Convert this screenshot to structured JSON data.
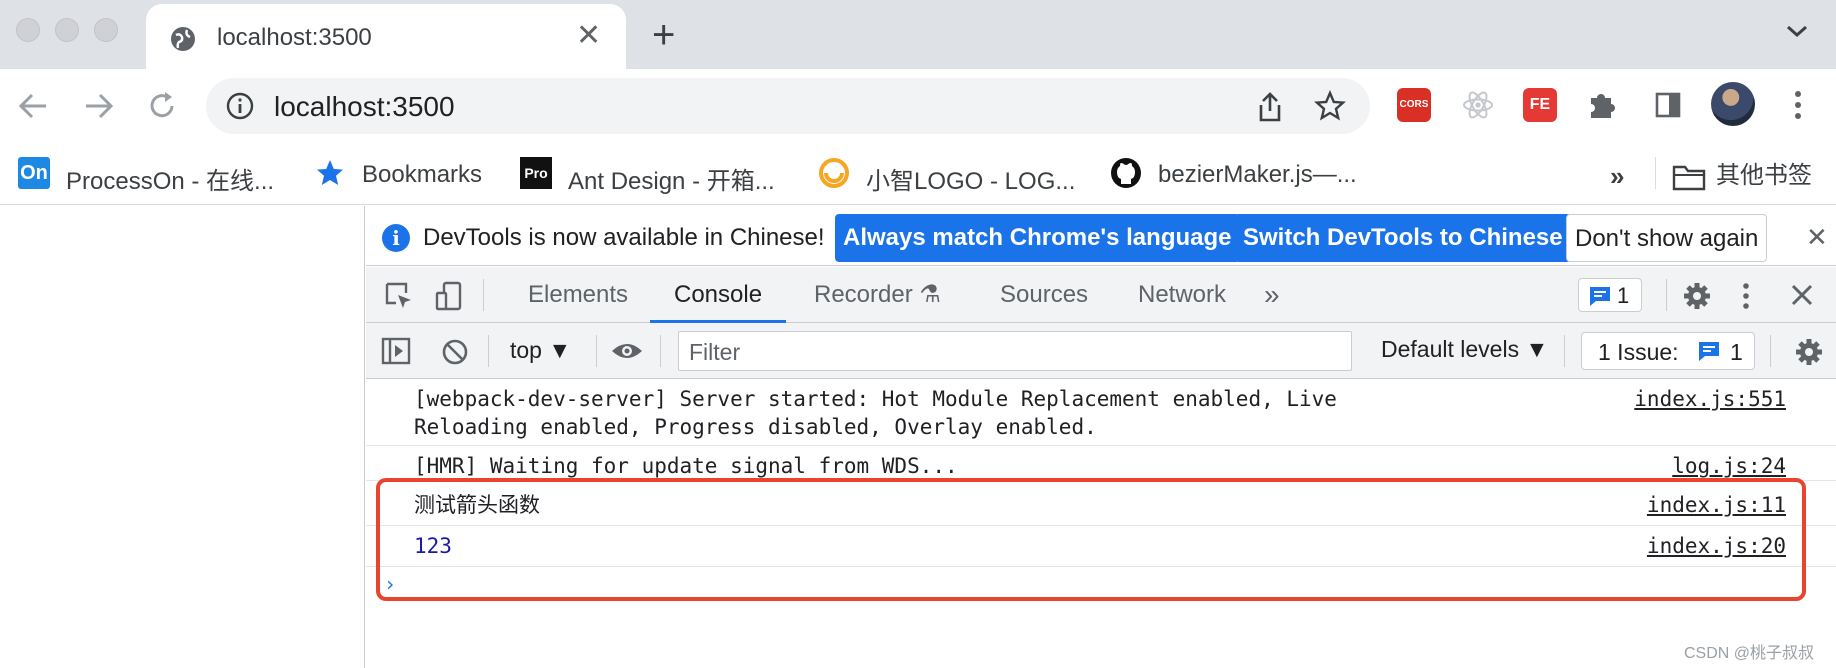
{
  "browser": {
    "tab": {
      "title": "localhost:3500",
      "close": "✕"
    },
    "new_tab": "+",
    "url": "localhost:3500",
    "extensions": {
      "cors": "CORS",
      "fe": "FE"
    }
  },
  "bookmarks": {
    "items": [
      {
        "icon_text": "On",
        "label": "ProcessOn - 在线..."
      },
      {
        "icon": "star-icon",
        "label": "Bookmarks"
      },
      {
        "icon_text": "Pro",
        "label": "Ant Design - 开箱..."
      },
      {
        "icon": "logo-icon",
        "label": "小智LOGO - LOG..."
      },
      {
        "icon": "github-icon",
        "label": "bezierMaker.js—..."
      }
    ],
    "more": "»",
    "other": "其他书签"
  },
  "devtools": {
    "infobar": {
      "icon": "i",
      "text": "DevTools is now available in Chinese!",
      "btn_match": "Always match Chrome's language",
      "btn_switch": "Switch DevTools to Chinese",
      "btn_dismiss": "Don't show again",
      "close": "✕"
    },
    "tabs": [
      "Elements",
      "Console",
      "Recorder ⚗",
      "Sources",
      "Network"
    ],
    "tabs_more": "»",
    "issue_count": "1",
    "console_bar": {
      "context": "top ▼",
      "filter_placeholder": "Filter",
      "levels": "Default levels ▼",
      "issues_label": "1 Issue:",
      "issues_count": "1"
    },
    "logs": [
      {
        "message": "[webpack-dev-server] Server started: Hot Module Replacement enabled, Live\nReloading enabled, Progress disabled, Overlay enabled.",
        "source": "index.js:551"
      },
      {
        "message": "[HMR] Waiting for update signal from WDS...",
        "source": "log.js:24"
      },
      {
        "message": "测试箭头函数",
        "source": "index.js:11"
      },
      {
        "message": "123",
        "source": "index.js:20"
      }
    ],
    "prompt": "›"
  },
  "watermark": "CSDN @桃子叔叔",
  "colors": {
    "accent": "#1a73e8",
    "highlight": "#e94430",
    "tabstrip": "#dee1e6"
  }
}
